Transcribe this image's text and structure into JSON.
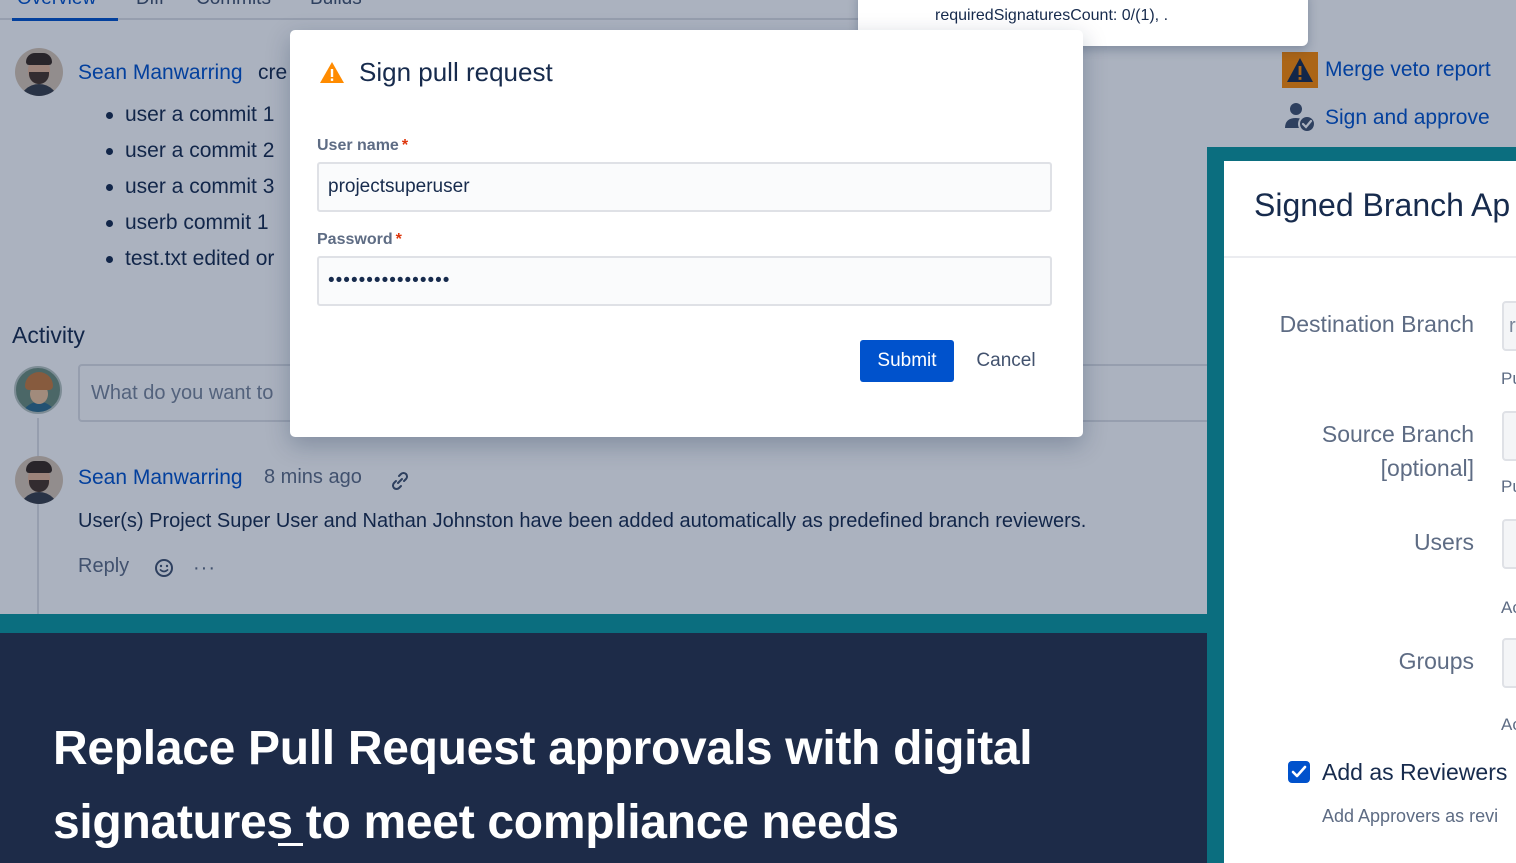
{
  "tabs": [
    "Overview",
    "Diff",
    "Commits",
    "Builds"
  ],
  "overview": {
    "author": "Sean Manwarring",
    "created_fragment": "cre",
    "commits": [
      "user a commit 1",
      "user a commit 2",
      "user a commit 3",
      "userb commit 1",
      "test.txt edited or"
    ]
  },
  "activity": {
    "title": "Activity",
    "comment_placeholder": "What do you want to",
    "comment": {
      "author": "Sean Manwarring",
      "time": "8 mins ago",
      "text": "User(s) Project Super User and Nathan Johnston have been added automatically as predefined branch reviewers.",
      "reply_label": "Reply",
      "more_label": "···"
    }
  },
  "side_actions": {
    "merge_veto": "Merge veto report",
    "sign_approve": "Sign and approve"
  },
  "tooltip": {
    "text": "requiredSignaturesCount: 0/(1), ."
  },
  "modal": {
    "title": "Sign pull request",
    "username_label": "User name",
    "username_value": "projectsuperuser",
    "password_label": "Password",
    "password_value": "••••••••••••••••",
    "required_marker": "*",
    "submit_label": "Submit",
    "cancel_label": "Cancel"
  },
  "right_panel": {
    "title": "Signed Branch Ap",
    "destination_label": "Destination Branch",
    "destination_value": "r",
    "destination_help": "Pu",
    "source_label_1": "Source Branch",
    "source_label_2": "[optional]",
    "source_help": "Pu",
    "users_label": "Users",
    "users_help": "Ac",
    "groups_label": "Groups",
    "groups_help": "Ac",
    "checkbox_label": "Add as Reviewers",
    "checkbox_desc": "Add Approvers as revi"
  },
  "banner": {
    "line1": "Replace Pull Request approvals with digital",
    "line2": "signatures to meet compliance needs"
  },
  "colors": {
    "accent": "#0052cc",
    "teal": "#0b6e7f",
    "banner_bg": "#1d2b48",
    "warning": "#ff8b00"
  }
}
